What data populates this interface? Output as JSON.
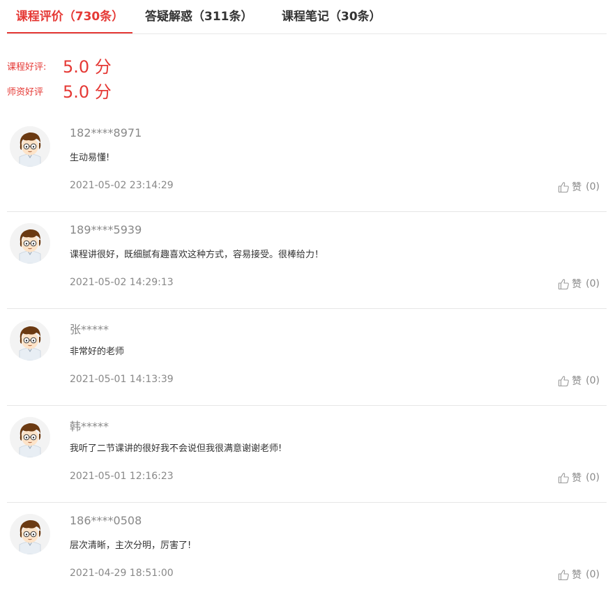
{
  "tabs": [
    {
      "label": "课程评价（730条）",
      "active": true
    },
    {
      "label": "答疑解惑（311条）",
      "active": false
    },
    {
      "label": "课程笔记（30条）",
      "active": false
    }
  ],
  "ratings": [
    {
      "label": "课程好评:",
      "value": "5.0 分"
    },
    {
      "label": "师资好评",
      "value": "5.0 分"
    }
  ],
  "comments": [
    {
      "user": "182****8971",
      "content": "生动易懂!",
      "time": "2021-05-02 23:14:29",
      "like_label": "赞",
      "like_count": "(0)"
    },
    {
      "user": "189****5939",
      "content": "课程讲很好，既细腻有趣喜欢这种方式，容易接受。很棒给力！",
      "time": "2021-05-02 14:29:13",
      "like_label": "赞",
      "like_count": "(0)"
    },
    {
      "user": "张*****",
      "content": "非常好的老师",
      "time": "2021-05-01 14:13:39",
      "like_label": "赞",
      "like_count": "(0)"
    },
    {
      "user": "韩*****",
      "content": "我听了二节课讲的很好我不会说但我很满意谢谢老师!",
      "time": "2021-05-01 12:16:23",
      "like_label": "赞",
      "like_count": "(0)"
    },
    {
      "user": "186****0508",
      "content": "层次清晰，主次分明，厉害了!",
      "time": "2021-04-29 18:51:00",
      "like_label": "赞",
      "like_count": "(0)"
    }
  ],
  "icons": {
    "avatar": "cartoon-avatar-icon",
    "like": "thumbs-up-icon"
  },
  "colors": {
    "accent": "#e53935",
    "muted": "#888888",
    "divider": "#e6e6e6"
  }
}
